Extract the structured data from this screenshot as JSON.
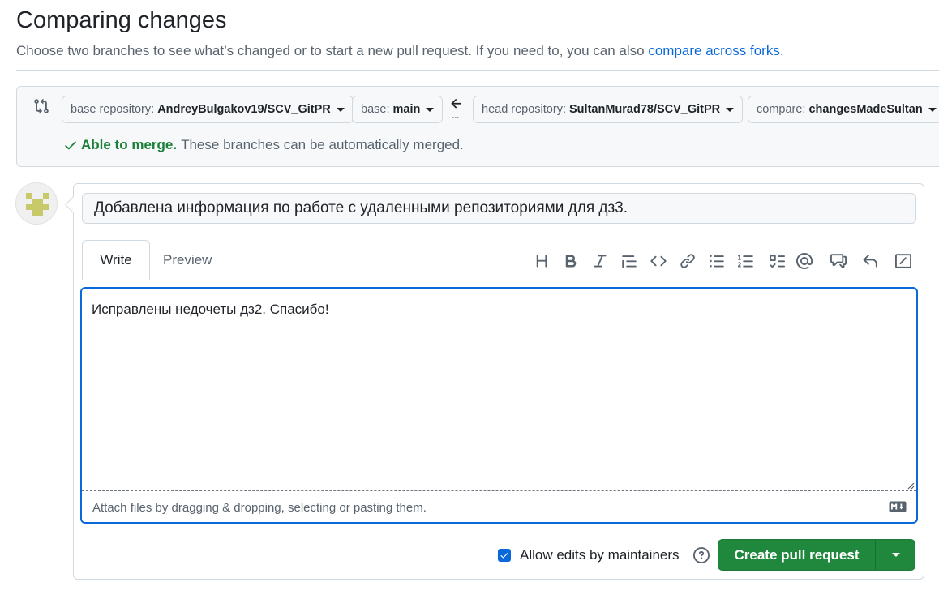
{
  "header": {
    "title": "Comparing changes",
    "subtitle": "Choose two branches to see what’s changed or to start a new pull request. If you need to, you can also ",
    "subtitle_link": "compare across forks",
    "subtitle_end": "."
  },
  "range": {
    "base_repository": {
      "label": "base repository:",
      "value": "AndreyBulgakov19/SCV_GitPR"
    },
    "base": {
      "label": "base:",
      "value": "main"
    },
    "arrow_dots": "...",
    "head_repository": {
      "label": "head repository:",
      "value": "SultanMurad78/SCV_GitPR"
    },
    "compare": {
      "label": "compare:",
      "value": "changesMadeSultan"
    },
    "merge_status_ok": "Able to merge.",
    "merge_status_text": "These branches can be automatically merged."
  },
  "form": {
    "pr_title": "Добавлена информация по работе с удаленными репозиториями для дз3.",
    "tabs": [
      {
        "label": "Write"
      },
      {
        "label": "Preview"
      }
    ],
    "toolbar_icons": [
      "heading-icon",
      "bold-icon",
      "italic-icon",
      "quote-icon",
      "code-icon",
      "link-icon",
      "unordered-list-icon",
      "ordered-list-icon",
      "task-list-icon",
      "mention-icon",
      "cross-reference-icon",
      "reply-icon",
      "slash-command-icon"
    ],
    "body_text": "Исправлены недочеты дз2. Спасибо!",
    "attach_hint": "Attach files by dragging & dropping, selecting or pasting them.",
    "allow_edits_label": "Allow edits by maintainers",
    "allow_edits_checked": true,
    "submit_label": "Create pull request"
  },
  "colors": {
    "accent": "#0969da",
    "success": "#1a7f37",
    "primary_button": "#1f883d",
    "avatar_identicon": "#c8c96a"
  }
}
